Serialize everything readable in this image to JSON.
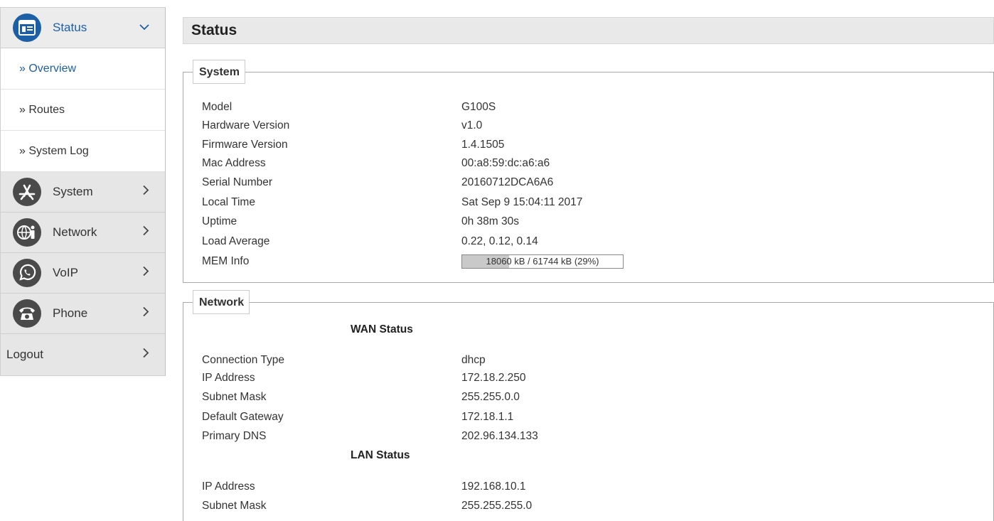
{
  "sidebar": {
    "status": {
      "label": "Status",
      "icon": "status-window-icon"
    },
    "sub_items": [
      {
        "label": "» Overview"
      },
      {
        "label": "» Routes"
      },
      {
        "label": "» System Log"
      }
    ],
    "system": {
      "label": "System",
      "icon": "app-store-icon"
    },
    "network": {
      "label": "Network",
      "icon": "globe-info-icon"
    },
    "voip": {
      "label": "VoIP",
      "icon": "whatsapp-phone-icon"
    },
    "phone": {
      "label": "Phone",
      "icon": "telephone-icon"
    },
    "logout": {
      "label": "Logout"
    }
  },
  "page": {
    "title": "Status"
  },
  "system_box": {
    "legend": "System",
    "rows": [
      {
        "key": "Model",
        "value": "G100S"
      },
      {
        "key": "Hardware Version",
        "value": "v1.0"
      },
      {
        "key": "Firmware Version",
        "value": "1.4.1505"
      },
      {
        "key": "Mac Address",
        "value": "00:a8:59:dc:a6:a6"
      },
      {
        "key": "Serial Number",
        "value": "20160712DCA6A6"
      },
      {
        "key": "Local Time",
        "value": "Sat Sep 9 15:04:11 2017"
      },
      {
        "key": "Uptime",
        "value": "0h 38m 30s"
      },
      {
        "key": "Load Average",
        "value": "0.22, 0.12, 0.14"
      }
    ],
    "mem": {
      "key": "MEM Info",
      "text": "18060 kB / 61744 kB (29%)",
      "percent": 29
    }
  },
  "network_box": {
    "legend": "Network",
    "wan_title": "WAN Status",
    "wan_rows": [
      {
        "key": "Connection Type",
        "value": "dhcp"
      },
      {
        "key": "IP Address",
        "value": "172.18.2.250"
      },
      {
        "key": "Subnet Mask",
        "value": "255.255.0.0"
      },
      {
        "key": "Default Gateway",
        "value": "172.18.1.1"
      },
      {
        "key": "Primary DNS",
        "value": "202.96.134.133"
      }
    ],
    "lan_title": "LAN Status",
    "lan_rows": [
      {
        "key": "IP Address",
        "value": "192.168.10.1"
      },
      {
        "key": "Subnet Mask",
        "value": "255.255.255.0"
      }
    ]
  },
  "colors": {
    "accent": "#1d5fa6",
    "nav_bg": "#e6e6e6"
  }
}
